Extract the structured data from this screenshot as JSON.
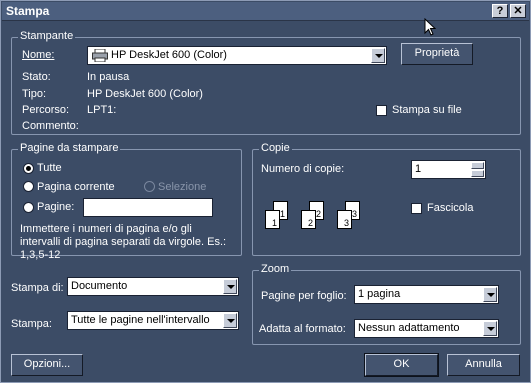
{
  "window": {
    "title": "Stampa",
    "help_btn": "?",
    "close_btn": "✕"
  },
  "printer": {
    "group_label": "Stampante",
    "name_label": "Nome:",
    "name_value": "HP DeskJet 600 (Color)",
    "properties_button": "Proprietà",
    "status_label": "Stato:",
    "status_value": "In pausa",
    "type_label": "Tipo:",
    "type_value": "HP DeskJet 600 (Color)",
    "path_label": "Percorso:",
    "path_value": "LPT1:",
    "comment_label": "Commento:",
    "comment_value": "",
    "print_to_file_label": "Stampa su file",
    "print_to_file_checked": false
  },
  "pages": {
    "group_label": "Pagine da stampare",
    "all_label": "Tutte",
    "current_label": "Pagina corrente",
    "selection_label": "Selezione",
    "pages_label": "Pagine:",
    "pages_value": "",
    "hint": "Immettere i numeri di pagina e/o gli intervalli di pagina separati da virgole. Es.: 1,3,5-12",
    "selected": "Tutte"
  },
  "copies": {
    "group_label": "Copie",
    "count_label": "Numero di copie:",
    "count_value": "1",
    "collate_label": "Fascicola",
    "collate_checked": false,
    "collate_pages": [
      "1",
      "1",
      "2",
      "2",
      "3",
      "3"
    ]
  },
  "print_what": {
    "label": "Stampa di:",
    "value": "Documento"
  },
  "print": {
    "label": "Stampa:",
    "value": "Tutte le pagine nell'intervallo"
  },
  "zoom": {
    "group_label": "Zoom",
    "pages_per_sheet_label": "Pagine per foglio:",
    "pages_per_sheet_value": "1 pagina",
    "scale_label": "Adatta al formato:",
    "scale_value": "Nessun adattamento"
  },
  "footer": {
    "options_button": "Opzioni...",
    "ok_button": "OK",
    "cancel_button": "Annulla"
  },
  "icons": {
    "printer": "printer-icon",
    "cursor": "mouse-cursor-icon"
  }
}
